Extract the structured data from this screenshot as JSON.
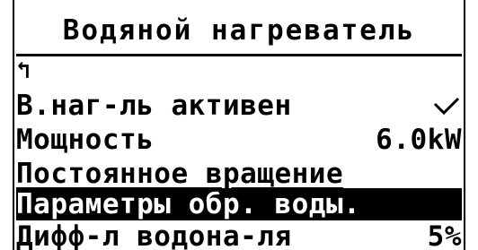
{
  "screen": {
    "title": "Водяной нагреватель",
    "back_symbol": "↰",
    "items": [
      {
        "label": "В.наг-ль активен",
        "value_icon": "check-mark-icon"
      },
      {
        "label": "Мощность",
        "value": "6.0kW"
      },
      {
        "label": "Постоянное вращение"
      },
      {
        "label": "Параметры обр. воды.",
        "selected": true
      },
      {
        "label": "Дифф-л водона-ля",
        "value": "5%"
      }
    ]
  }
}
